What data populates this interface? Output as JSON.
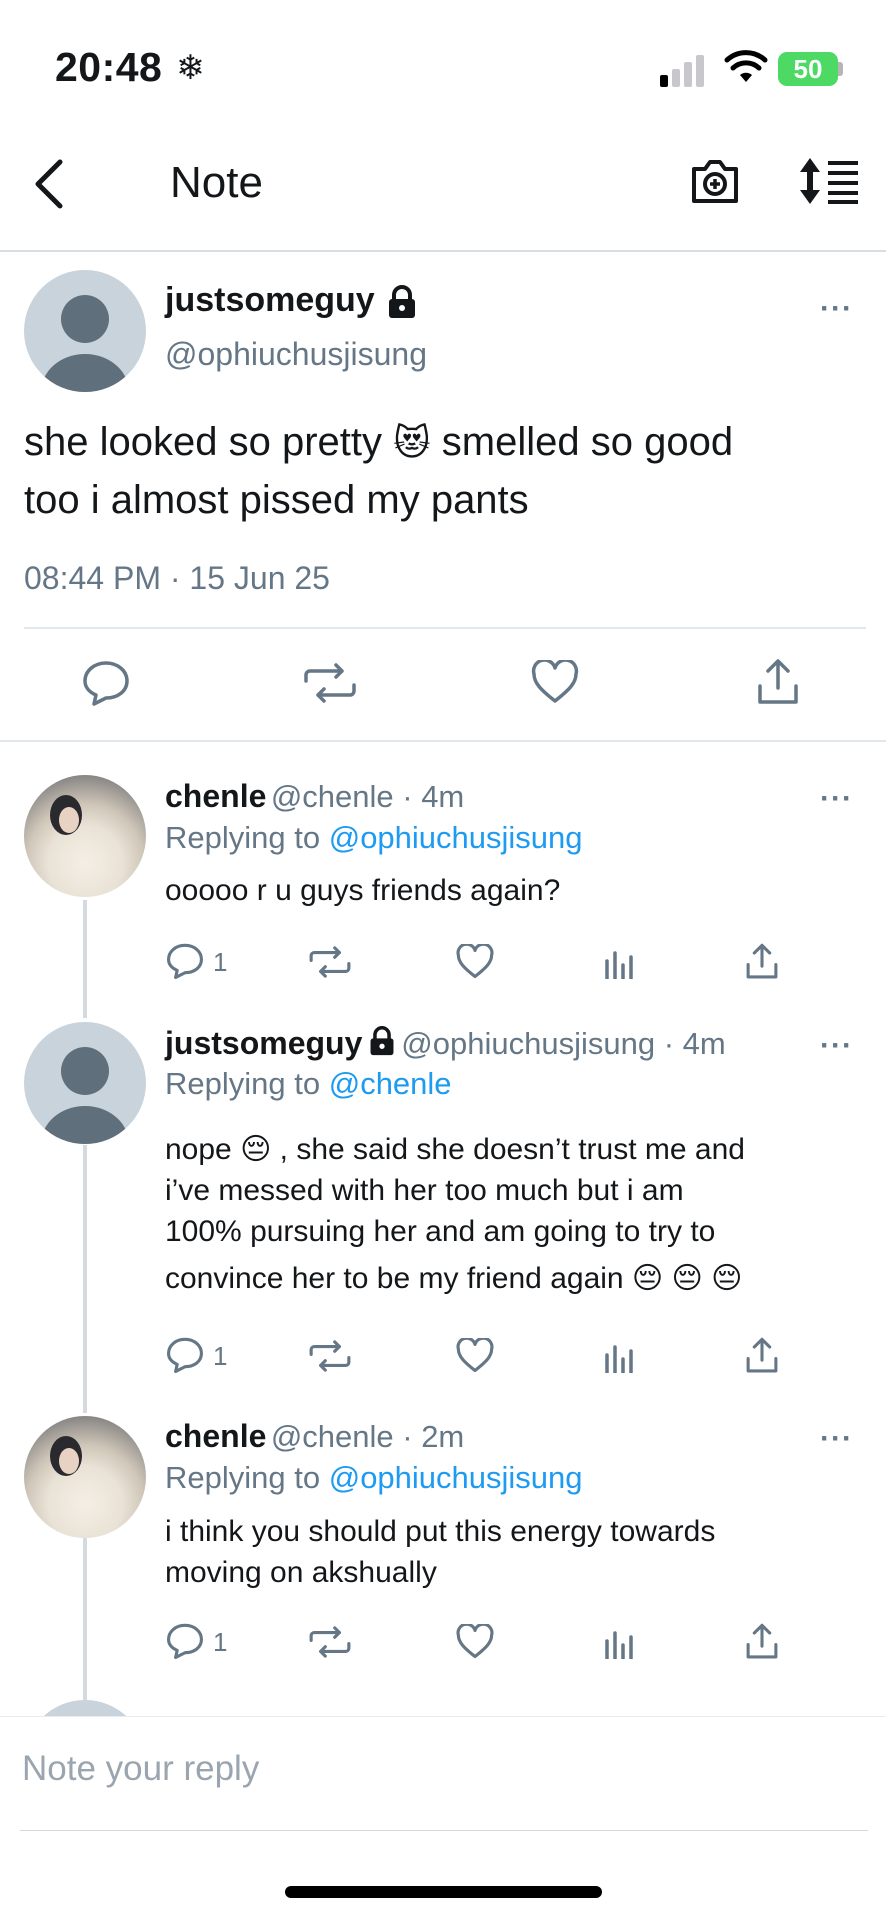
{
  "status": {
    "time": "20:48",
    "weather_glyph": "❄",
    "battery": "50"
  },
  "header": {
    "title": "Note"
  },
  "main_post": {
    "display_name": "justsomeguy",
    "handle": "@ophiuchusjisung",
    "text_part1": "she looked so pretty",
    "emoji": "😻",
    "text_part2": "smelled so good",
    "text_line2": "too i almost pissed my pants",
    "timestamp": "08:44 PM · 15 Jun 25",
    "more": "···"
  },
  "replies": [
    {
      "display_name": "chenle",
      "meta": "@chenle · 4m",
      "replying_prefix": "Replying to",
      "replying_to": "@ophiuchusjisung",
      "text_lines": [
        "ooooo r u guys friends again?"
      ],
      "reply_count": "1",
      "more": "···"
    },
    {
      "display_name": "justsomeguy",
      "meta": "@ophiuchusjisung · 4m",
      "replying_prefix": "Replying to",
      "replying_to": "@chenle",
      "text_lines": [
        "nope 😔 , she said she doesn’t trust me and",
        "i’ve messed with her too much but i am",
        "100% pursuing her and am going to try to",
        "convince her to be my friend again 😔 😔 😔"
      ],
      "reply_count": "1",
      "more": "···"
    },
    {
      "display_name": "chenle",
      "meta": "@chenle · 2m",
      "replying_prefix": "Replying to",
      "replying_to": "@ophiuchusjisung",
      "text_lines": [
        "i think you should put this energy towards",
        "moving on akshually"
      ],
      "reply_count": "1",
      "more": "···"
    }
  ],
  "reply_box": {
    "placeholder": "Note your reply"
  },
  "colors": {
    "accent": "#1d9bf0",
    "muted": "#657786",
    "battery": "#4cd964"
  }
}
